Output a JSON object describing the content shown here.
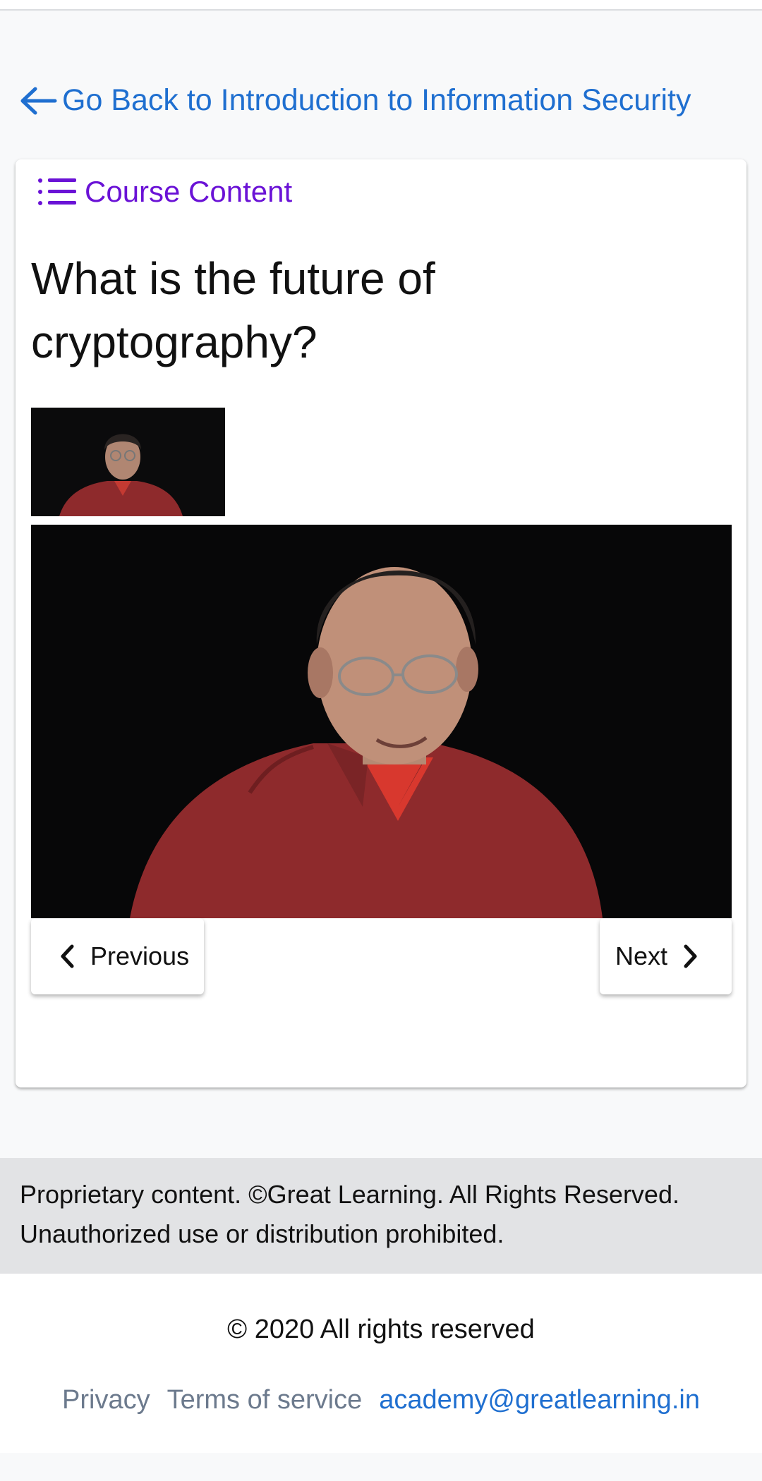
{
  "back_link": {
    "label": "Go Back to Introduction to Information Security",
    "icon": "arrow-left-icon"
  },
  "course_content": {
    "label": "Course Content",
    "icon": "list-icon"
  },
  "lesson": {
    "title": "What is the future of cryptography?"
  },
  "navigation": {
    "previous_label": "Previous",
    "next_label": "Next"
  },
  "notice": {
    "text": "Proprietary content. ©Great Learning. All Rights Reserved. Unauthorized use or distribution prohibited."
  },
  "footer": {
    "copyright": "© 2020 All rights reserved",
    "privacy_label": "Privacy",
    "terms_label": "Terms of service",
    "email": "academy@greatlearning.in"
  },
  "colors": {
    "link_blue": "#1f6fd0",
    "course_purple": "#6a12d6",
    "footer_gray": "#6c7a8d",
    "notice_bg": "#e2e3e5",
    "video_bg": "#070708",
    "shirt_red": "#8e2a2c"
  }
}
